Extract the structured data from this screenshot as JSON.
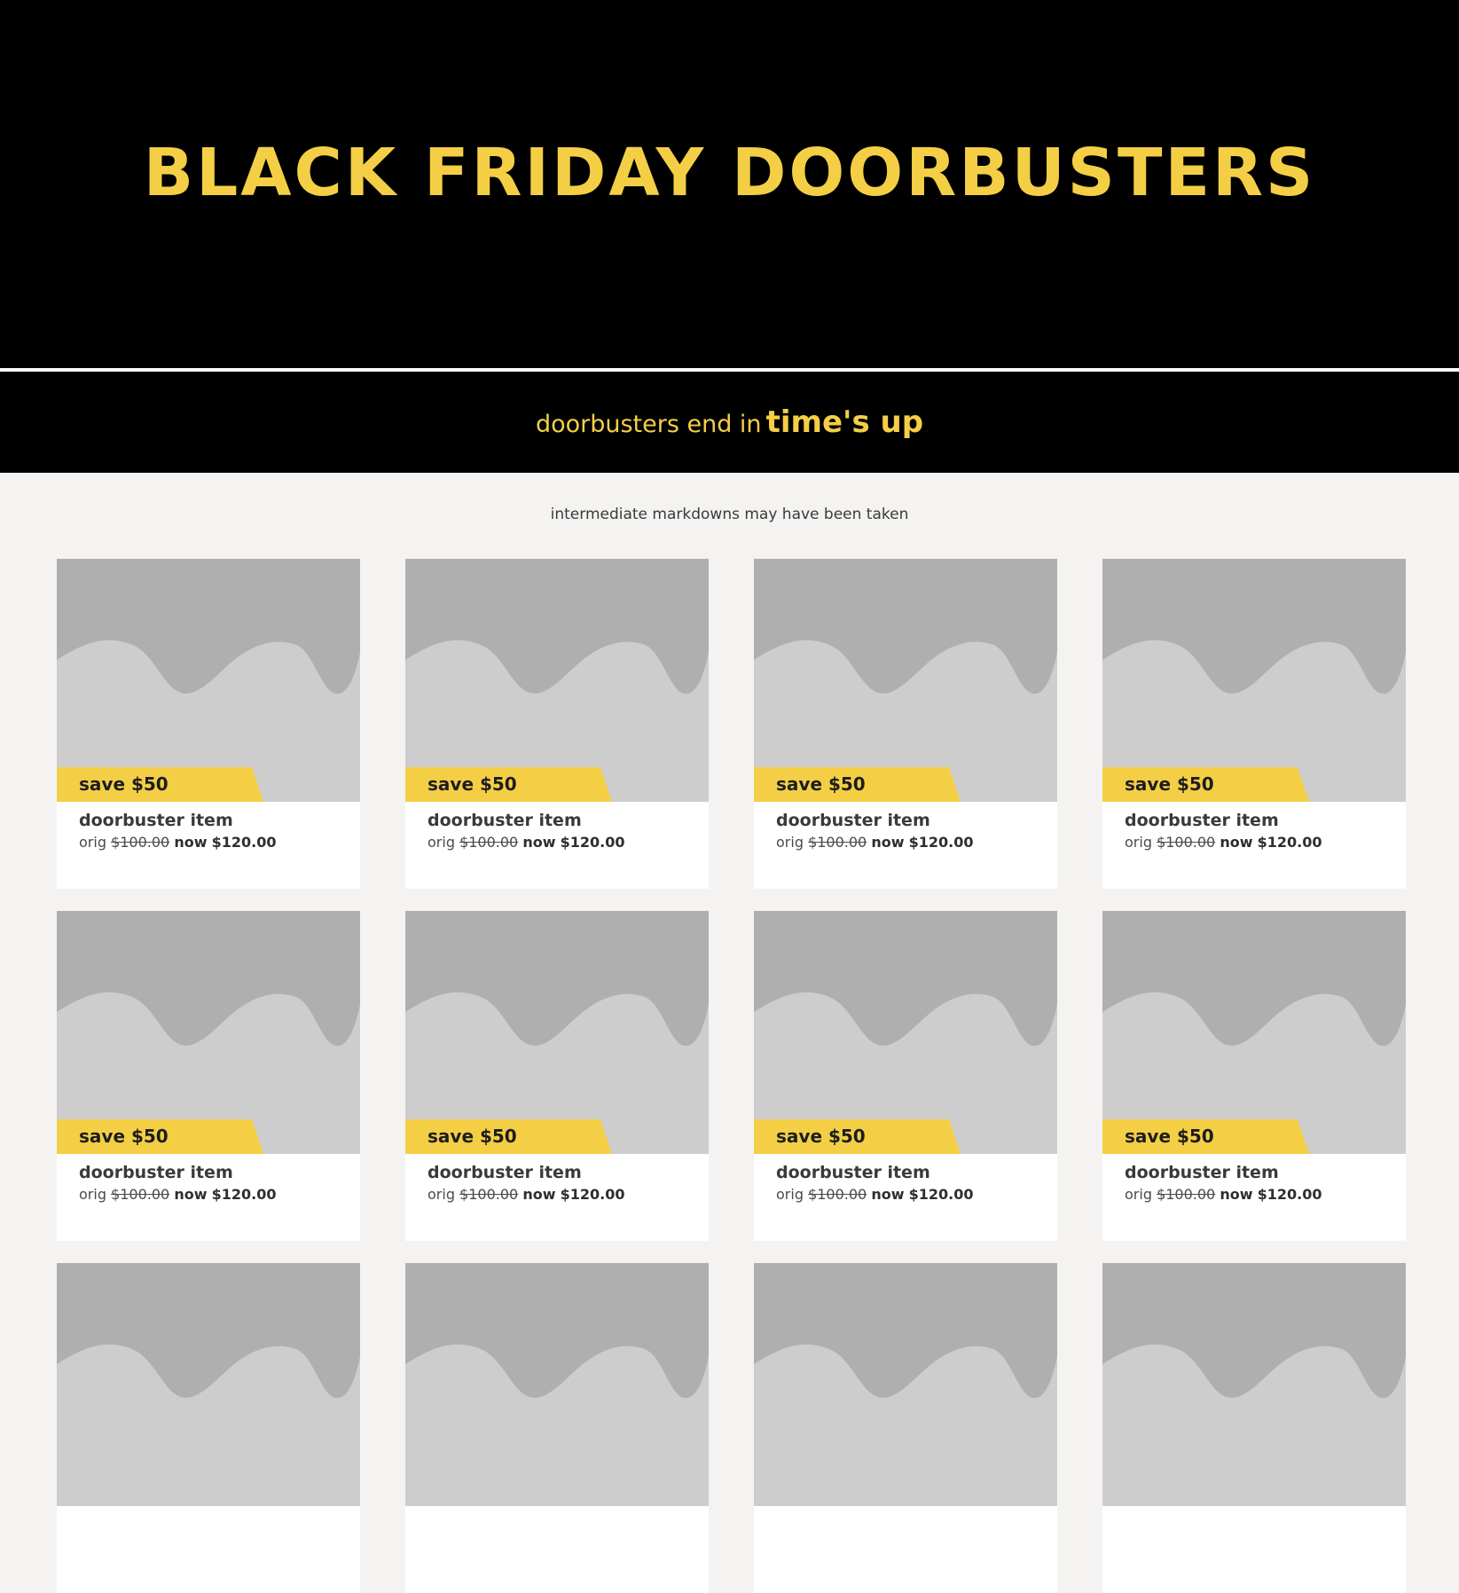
{
  "hero": {
    "title": "BLACK FRIDAY DOORBUSTERS"
  },
  "countdown": {
    "prefix": "doorbusters end in",
    "value": "time's up"
  },
  "disclaimer": "intermediate markdowns may have been taken",
  "colors": {
    "accent_yellow": "#f4cf45",
    "hero_background": "#000000",
    "page_background": "#f4f3f1",
    "placeholder_dark": "#afafaf",
    "placeholder_light": "#cecdcd"
  },
  "products": [
    {
      "save": "save $50",
      "name": "doorbuster item",
      "orig_label": "orig",
      "orig_price": "$100.00",
      "now_label": "now",
      "now_price": "$120.00",
      "image_icon": "image-placeholder-icon"
    },
    {
      "save": "save $50",
      "name": "doorbuster item",
      "orig_label": "orig",
      "orig_price": "$100.00",
      "now_label": "now",
      "now_price": "$120.00",
      "image_icon": "image-placeholder-icon"
    },
    {
      "save": "save $50",
      "name": "doorbuster item",
      "orig_label": "orig",
      "orig_price": "$100.00",
      "now_label": "now",
      "now_price": "$120.00",
      "image_icon": "image-placeholder-icon"
    },
    {
      "save": "save $50",
      "name": "doorbuster item",
      "orig_label": "orig",
      "orig_price": "$100.00",
      "now_label": "now",
      "now_price": "$120.00",
      "image_icon": "image-placeholder-icon"
    },
    {
      "save": "save $50",
      "name": "doorbuster item",
      "orig_label": "orig",
      "orig_price": "$100.00",
      "now_label": "now",
      "now_price": "$120.00",
      "image_icon": "image-placeholder-icon"
    },
    {
      "save": "save $50",
      "name": "doorbuster item",
      "orig_label": "orig",
      "orig_price": "$100.00",
      "now_label": "now",
      "now_price": "$120.00",
      "image_icon": "image-placeholder-icon"
    },
    {
      "save": "save $50",
      "name": "doorbuster item",
      "orig_label": "orig",
      "orig_price": "$100.00",
      "now_label": "now",
      "now_price": "$120.00",
      "image_icon": "image-placeholder-icon"
    },
    {
      "save": "save $50",
      "name": "doorbuster item",
      "orig_label": "orig",
      "orig_price": "$100.00",
      "now_label": "now",
      "now_price": "$120.00",
      "image_icon": "image-placeholder-icon"
    },
    {
      "image_icon": "image-placeholder-icon"
    },
    {
      "image_icon": "image-placeholder-icon"
    },
    {
      "image_icon": "image-placeholder-icon"
    },
    {
      "image_icon": "image-placeholder-icon"
    }
  ]
}
